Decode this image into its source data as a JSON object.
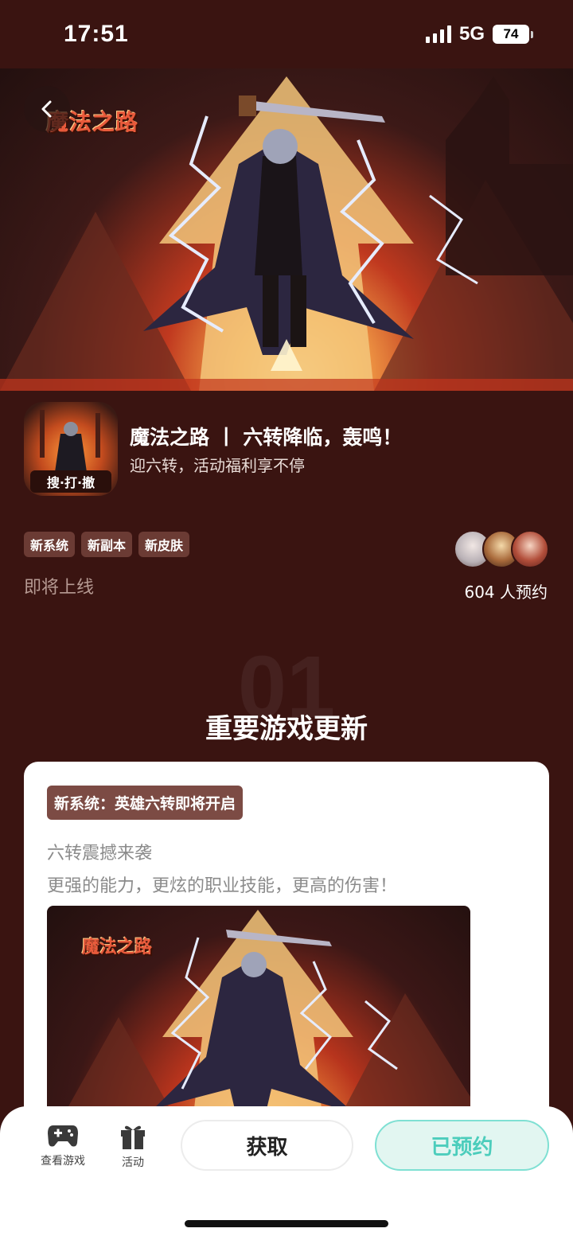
{
  "status_bar": {
    "time": "17:51",
    "network": "5G",
    "battery": "74"
  },
  "hero": {
    "logo_text": "魔法之路"
  },
  "game": {
    "title": "魔法之路 丨 六转降临，轰鸣！",
    "subtitle": "迎六转，活动福利享不停",
    "icon_label": "搜·打·撤",
    "tags": [
      "新系统",
      "新副本",
      "新皮肤"
    ],
    "release_status": "即将上线",
    "reservation_count": "604 人预约"
  },
  "section": {
    "number": "01",
    "title": "重要游戏更新"
  },
  "card": {
    "tag": "新系统：英雄六转即将开启",
    "line1": "六转震撼来袭",
    "line2": "更强的能力，更炫的职业技能，更高的伤害！",
    "image_logo_text": "魔法之路"
  },
  "bottom_bar": {
    "nav_game": "查看游戏",
    "nav_activity": "活动",
    "get_button": "获取",
    "reserved_button": "已预约"
  },
  "colors": {
    "background": "#3a1411",
    "reserved_accent": "#4ccdbc",
    "tag_background": "#6b3b34"
  }
}
